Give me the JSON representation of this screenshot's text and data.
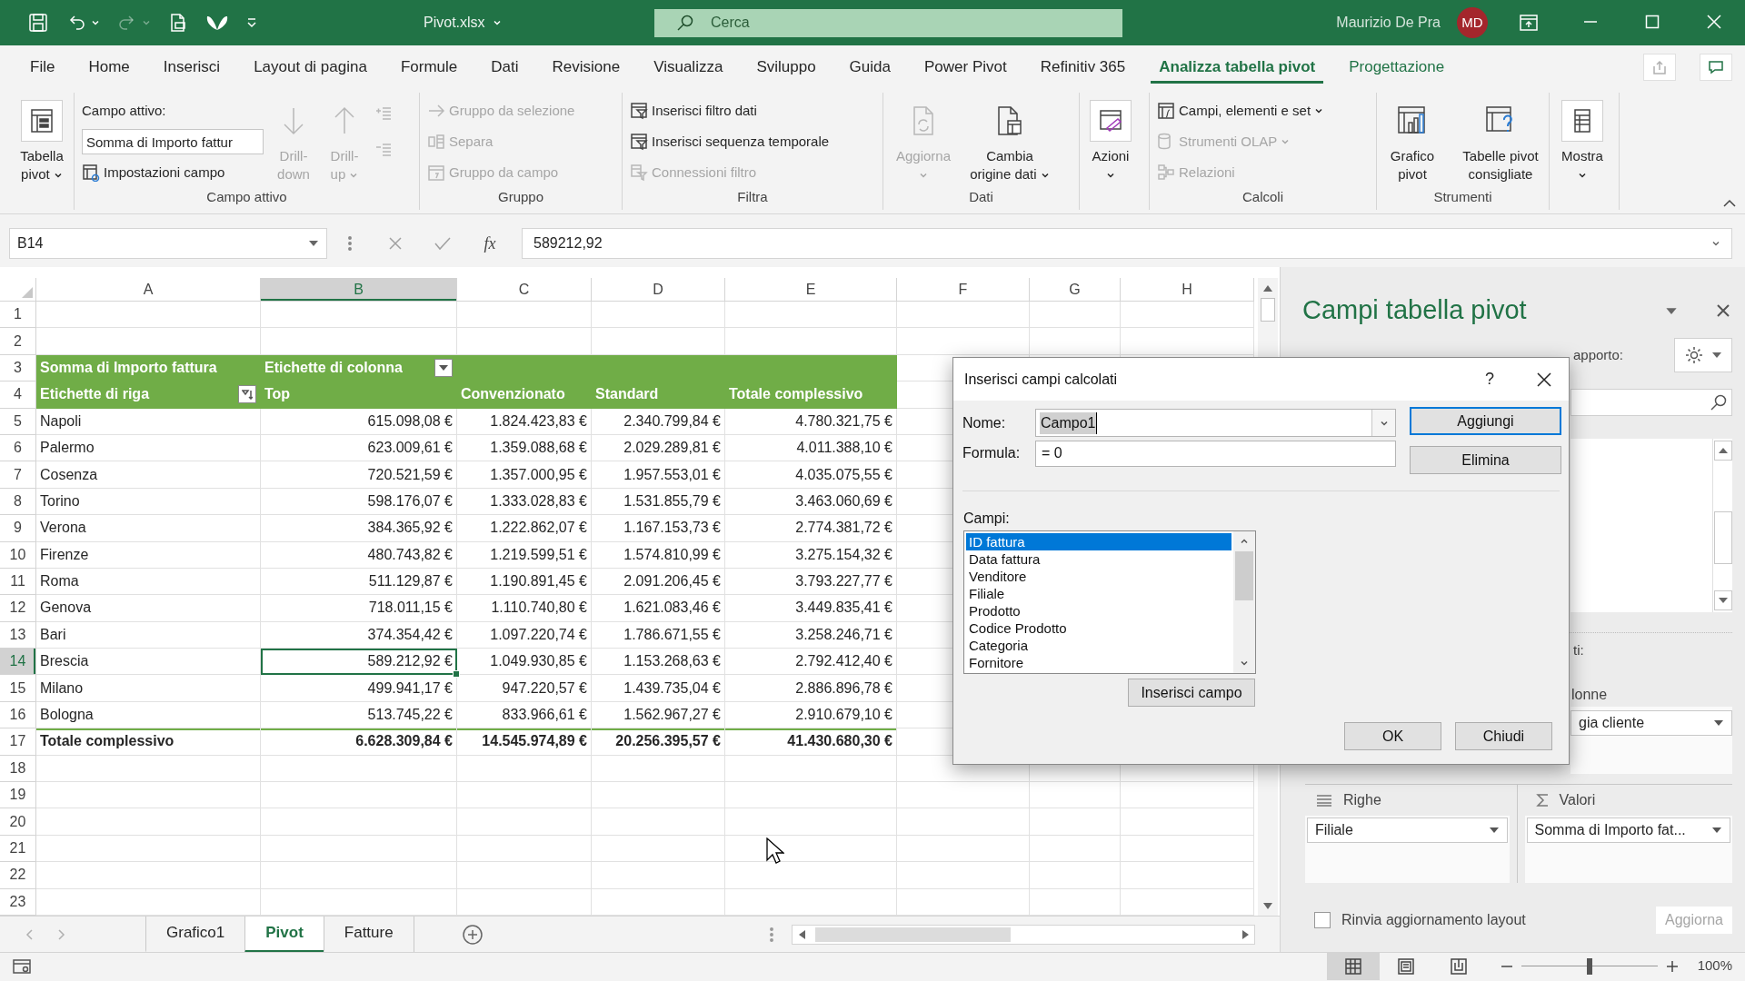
{
  "title_bar": {
    "file_name": "Pivot.xlsx",
    "search_placeholder": "Cerca",
    "user_name": "Maurizio De Pra",
    "avatar_initials": "MD"
  },
  "menu_tabs": [
    {
      "label": "File",
      "selected": false,
      "contextual": false
    },
    {
      "label": "Home",
      "selected": false,
      "contextual": false
    },
    {
      "label": "Inserisci",
      "selected": false,
      "contextual": false
    },
    {
      "label": "Layout di pagina",
      "selected": false,
      "contextual": false
    },
    {
      "label": "Formule",
      "selected": false,
      "contextual": false
    },
    {
      "label": "Dati",
      "selected": false,
      "contextual": false
    },
    {
      "label": "Revisione",
      "selected": false,
      "contextual": false
    },
    {
      "label": "Visualizza",
      "selected": false,
      "contextual": false
    },
    {
      "label": "Sviluppo",
      "selected": false,
      "contextual": false
    },
    {
      "label": "Guida",
      "selected": false,
      "contextual": false
    },
    {
      "label": "Power Pivot",
      "selected": false,
      "contextual": false
    },
    {
      "label": "Refinitiv 365",
      "selected": false,
      "contextual": false
    },
    {
      "label": "Analizza tabella pivot",
      "selected": true,
      "contextual": true
    },
    {
      "label": "Progettazione",
      "selected": false,
      "contextual": true
    }
  ],
  "ribbon_groups": [
    {
      "items": [
        {
          "kind": "large",
          "label": "Tabella pivot",
          "dropdown": true,
          "disabled": false
        }
      ]
    },
    {
      "label": "Campo attivo",
      "items": [
        {
          "kind": "caption",
          "label": "Campo attivo:"
        },
        {
          "kind": "field",
          "value": "Somma di Importo fattur"
        },
        {
          "kind": "small",
          "label": "Impostazioni campo",
          "dropdown": false,
          "disabled": false
        },
        {
          "kind": "large",
          "label": "Drill-down",
          "dropdown": false,
          "disabled": true
        },
        {
          "kind": "large",
          "label": "Drill-up",
          "dropdown": true,
          "disabled": true
        },
        {
          "kind": "icon",
          "disabled": true
        },
        {
          "kind": "icon",
          "disabled": true
        }
      ]
    },
    {
      "label": "Gruppo",
      "items": [
        {
          "kind": "small",
          "label": "Gruppo da selezione",
          "dropdown": false,
          "disabled": true
        },
        {
          "kind": "small",
          "label": "Separa",
          "dropdown": false,
          "disabled": true
        },
        {
          "kind": "small",
          "label": "Gruppo da campo",
          "dropdown": false,
          "disabled": true
        }
      ]
    },
    {
      "label": "Filtra",
      "items": [
        {
          "kind": "small",
          "label": "Inserisci filtro dati",
          "dropdown": false,
          "disabled": false
        },
        {
          "kind": "small",
          "label": "Inserisci sequenza temporale",
          "dropdown": false,
          "disabled": false
        },
        {
          "kind": "small",
          "label": "Connessioni filtro",
          "dropdown": false,
          "disabled": true
        }
      ]
    },
    {
      "label": "Dati",
      "items": [
        {
          "kind": "large",
          "label": "Aggiorna",
          "dropdown": true,
          "disabled": true
        },
        {
          "kind": "large",
          "label": "Cambia origine dati",
          "dropdown": true,
          "disabled": false
        }
      ]
    },
    {
      "items": [
        {
          "kind": "large",
          "label": "Azioni",
          "dropdown": true,
          "disabled": false
        }
      ]
    },
    {
      "label": "Calcoli",
      "items": [
        {
          "kind": "small",
          "label": "Campi, elementi e set",
          "dropdown": true,
          "disabled": false
        },
        {
          "kind": "small",
          "label": "Strumenti OLAP",
          "dropdown": true,
          "disabled": true
        },
        {
          "kind": "small",
          "label": "Relazioni",
          "dropdown": false,
          "disabled": true
        }
      ]
    },
    {
      "label": "Strumenti",
      "items": [
        {
          "kind": "large",
          "label": "Grafico pivot",
          "dropdown": false,
          "disabled": false
        },
        {
          "kind": "large",
          "label": "Tabelle pivot consigliate",
          "dropdown": false,
          "disabled": false
        }
      ]
    },
    {
      "items": [
        {
          "kind": "large",
          "label": "Mostra",
          "dropdown": true,
          "disabled": false
        }
      ]
    }
  ],
  "formula_bar": {
    "name_box": "B14",
    "function_label": "fx",
    "value": "589212,92"
  },
  "sheet": {
    "columns": [
      {
        "label": "A",
        "selected": false
      },
      {
        "label": "B",
        "selected": true
      },
      {
        "label": "C",
        "selected": false
      },
      {
        "label": "D",
        "selected": false
      },
      {
        "label": "E",
        "selected": false
      },
      {
        "label": "F",
        "selected": false
      },
      {
        "label": "G",
        "selected": false
      },
      {
        "label": "H",
        "selected": false
      }
    ],
    "rows": [
      {
        "label": "1",
        "selected": false
      },
      {
        "label": "2",
        "selected": false
      },
      {
        "label": "3",
        "selected": false
      },
      {
        "label": "4",
        "selected": false
      },
      {
        "label": "5",
        "selected": false
      },
      {
        "label": "6",
        "selected": false
      },
      {
        "label": "7",
        "selected": false
      },
      {
        "label": "8",
        "selected": false
      },
      {
        "label": "9",
        "selected": false
      },
      {
        "label": "10",
        "selected": false
      },
      {
        "label": "11",
        "selected": false
      },
      {
        "label": "12",
        "selected": false
      },
      {
        "label": "13",
        "selected": false
      },
      {
        "label": "14",
        "selected": true
      },
      {
        "label": "15",
        "selected": false
      },
      {
        "label": "16",
        "selected": false
      },
      {
        "label": "17",
        "selected": false
      },
      {
        "label": "18",
        "selected": false
      },
      {
        "label": "19",
        "selected": false
      },
      {
        "label": "20",
        "selected": false
      },
      {
        "label": "21",
        "selected": false
      },
      {
        "label": "22",
        "selected": false
      },
      {
        "label": "23",
        "selected": false
      }
    ],
    "pivot": [
      {
        "kind": "header",
        "cells": [
          "Somma di Importo fattura",
          "Etichette di colonna"
        ]
      },
      {
        "kind": "subheader",
        "cells": [
          "Etichette di riga",
          "Top",
          "Convenzionato",
          "Standard",
          "Totale complessivo"
        ]
      },
      {
        "kind": "data",
        "cells": [
          "Napoli",
          "615.098,08 €",
          "1.824.423,83 €",
          "2.340.799,84 €",
          "4.780.321,75 €"
        ]
      },
      {
        "kind": "data",
        "cells": [
          "Palermo",
          "623.009,61 €",
          "1.359.088,68 €",
          "2.029.289,81 €",
          "4.011.388,10 €"
        ]
      },
      {
        "kind": "data",
        "cells": [
          "Cosenza",
          "720.521,59 €",
          "1.357.000,95 €",
          "1.957.553,01 €",
          "4.035.075,55 €"
        ]
      },
      {
        "kind": "data",
        "cells": [
          "Torino",
          "598.176,07 €",
          "1.333.028,83 €",
          "1.531.855,79 €",
          "3.463.060,69 €"
        ]
      },
      {
        "kind": "data",
        "cells": [
          "Verona",
          "384.365,92 €",
          "1.222.862,07 €",
          "1.167.153,73 €",
          "2.774.381,72 €"
        ]
      },
      {
        "kind": "data",
        "cells": [
          "Firenze",
          "480.743,82 €",
          "1.219.599,51 €",
          "1.574.810,99 €",
          "3.275.154,32 €"
        ]
      },
      {
        "kind": "data",
        "cells": [
          "Roma",
          "511.129,87 €",
          "1.190.891,45 €",
          "2.091.206,45 €",
          "3.793.227,77 €"
        ]
      },
      {
        "kind": "data",
        "cells": [
          "Genova",
          "718.011,15 €",
          "1.110.740,80 €",
          "1.621.083,46 €",
          "3.449.835,41 €"
        ]
      },
      {
        "kind": "data",
        "cells": [
          "Bari",
          "374.354,42 €",
          "1.097.220,74 €",
          "1.786.671,55 €",
          "3.258.246,71 €"
        ]
      },
      {
        "kind": "data",
        "cells": [
          "Brescia",
          "589.212,92 €",
          "1.049.930,85 €",
          "1.153.268,63 €",
          "2.792.412,40 €"
        ]
      },
      {
        "kind": "data",
        "cells": [
          "Milano",
          "499.941,17 €",
          "947.220,57 €",
          "1.439.735,04 €",
          "2.886.896,78 €"
        ]
      },
      {
        "kind": "data",
        "cells": [
          "Bologna",
          "513.745,22 €",
          "833.966,61 €",
          "1.562.967,27 €",
          "2.910.679,10 €"
        ]
      },
      {
        "kind": "total",
        "cells": [
          "Totale complessivo",
          "6.628.309,84 €",
          "14.545.974,89 €",
          "20.256.395,57 €",
          "41.430.680,30 €"
        ]
      }
    ]
  },
  "sheet_tabs": [
    {
      "label": "Grafico1",
      "selected": false
    },
    {
      "label": "Pivot",
      "selected": true
    },
    {
      "label": "Fatture",
      "selected": false
    }
  ],
  "status_bar": {
    "views": [
      {
        "selected": true
      },
      {
        "selected": false
      },
      {
        "selected": false
      }
    ],
    "zoom": {
      "level": 0.5,
      "reading": "100%"
    }
  },
  "pivot_pane": {
    "title": "Campi tabella pivot",
    "subtitle_fragment": "apporto:",
    "areas_hint_fragment": "ti:",
    "columns_area": {
      "label_fragment": "lonne",
      "field_fragment": "gia cliente"
    },
    "rows_area": {
      "label": "Righe",
      "field": "Filiale"
    },
    "values_area": {
      "label": "Valori",
      "field": "Somma di Importo fat..."
    },
    "defer_update": {
      "label": "Rinvia aggiornamento layout",
      "checked": false
    },
    "update_button": {
      "label": "Aggiorna",
      "disabled": true
    }
  },
  "dialog": {
    "title": "Inserisci campi calcolati",
    "help": "?",
    "name_label": "Nome:",
    "name_value": "Campo1",
    "formula_label": "Formula:",
    "formula_value": "= 0",
    "side_buttons": [
      {
        "label": "Aggiungi",
        "default": true
      },
      {
        "label": "Elimina",
        "default": false
      }
    ],
    "fields_label": "Campi:",
    "fields": [
      {
        "label": "ID fattura",
        "selected": true
      },
      {
        "label": "Data fattura",
        "selected": false
      },
      {
        "label": "Venditore",
        "selected": false
      },
      {
        "label": "Filiale",
        "selected": false
      },
      {
        "label": "Prodotto",
        "selected": false
      },
      {
        "label": "Codice Prodotto",
        "selected": false
      },
      {
        "label": "Categoria",
        "selected": false
      },
      {
        "label": "Fornitore",
        "selected": false
      }
    ],
    "insert_button": "Inserisci campo",
    "bottom_buttons": [
      "OK",
      "Chiudi"
    ]
  }
}
